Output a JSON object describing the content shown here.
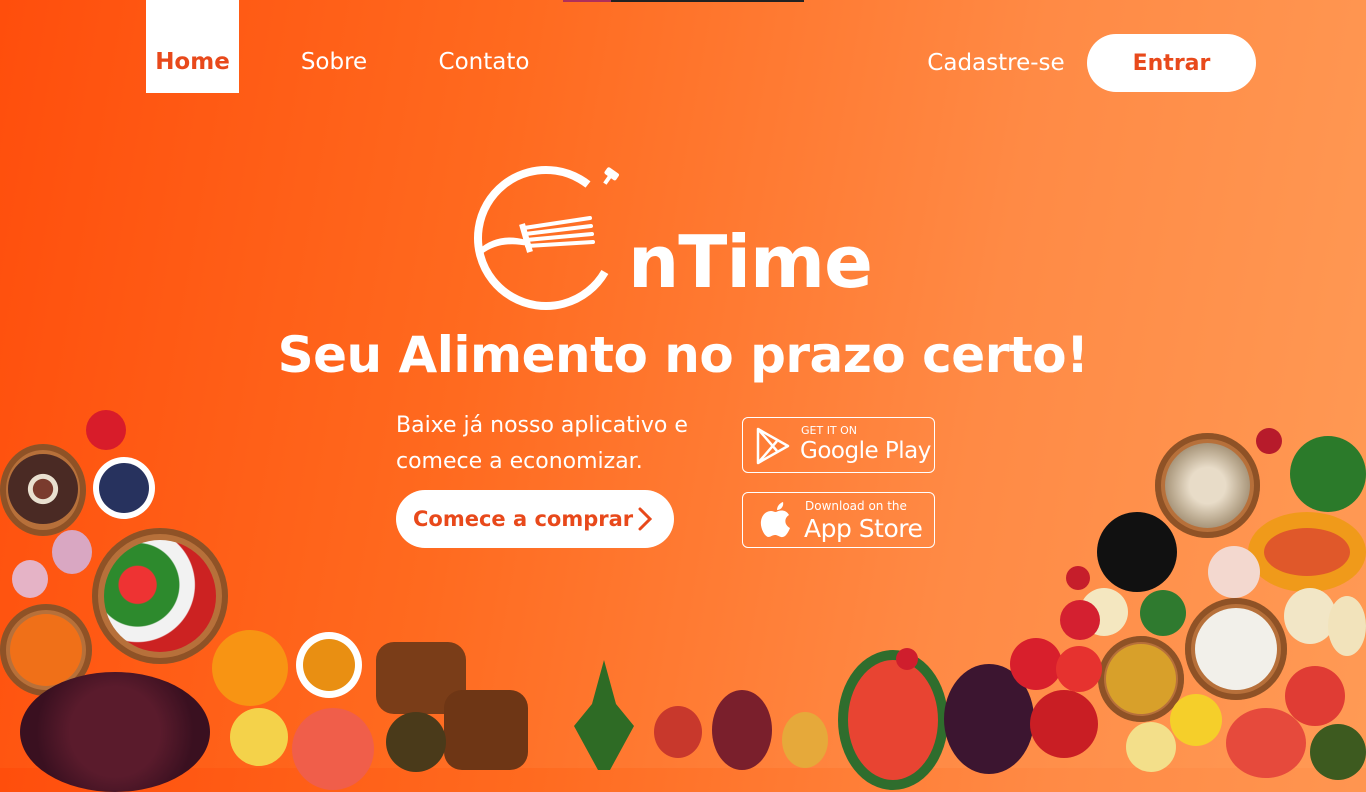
{
  "nav": {
    "home": "Home",
    "sobre": "Sobre",
    "contato": "Contato",
    "signup": "Cadastre-se",
    "login": "Entrar"
  },
  "logo": {
    "text": "nTime"
  },
  "hero": {
    "headline": "Seu Alimento no prazo certo!",
    "sub_line1": "Baixe já nosso aplicativo e",
    "sub_line2": "comece a economizar.",
    "cta": "Comece a comprar"
  },
  "stores": {
    "google_small": "GET IT ON",
    "google_big": "Google Play",
    "apple_small": "Download on the",
    "apple_big": "App Store"
  },
  "colors": {
    "accent": "#e8491b",
    "gradient_start": "#ff4e0c",
    "gradient_end": "#ff9a55"
  }
}
